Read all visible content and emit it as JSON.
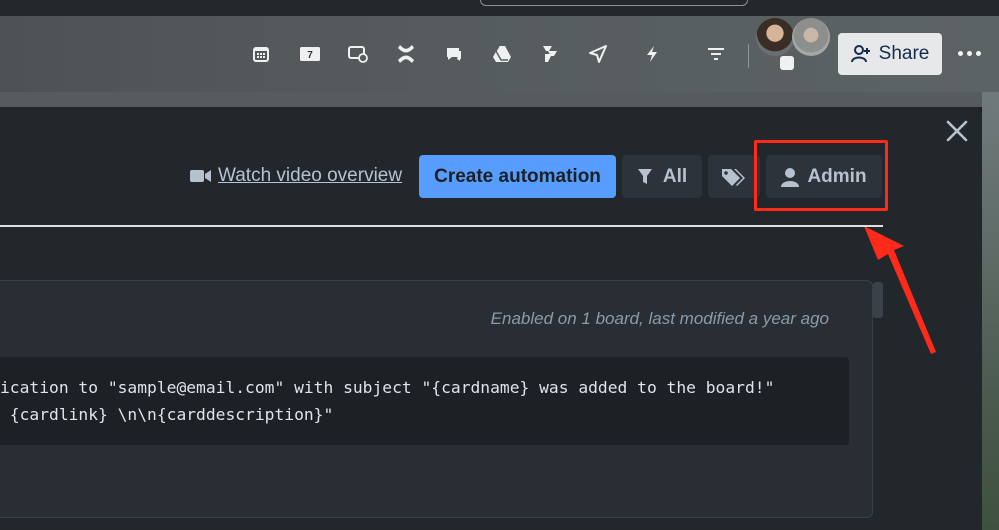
{
  "header": {
    "icons": [
      "calendar-icon",
      "calendar-day-icon",
      "screen-sync-icon",
      "confluence-icon",
      "comment-icon",
      "google-drive-icon",
      "jira-icon",
      "send-icon",
      "lightning-icon",
      "filter-lines-icon"
    ],
    "calendar_day_number": "7",
    "share_label": "Share"
  },
  "toolbar": {
    "video_link": "Watch video overview",
    "create_automation": "Create automation",
    "filter_label": "All",
    "admin_label": "Admin"
  },
  "rule": {
    "meta": "Enabled on 1 board, last modified a year ago",
    "code_line1": "ication to \"sample@email.com\" with subject \"{cardname} was added to the board!\"",
    "code_line2": " {cardlink} \\n\\n{carddescription}\""
  },
  "colors": {
    "accent": "#579dff",
    "highlight": "#ff2a1a",
    "modal_bg": "#22272b",
    "button_bg": "#2c333a"
  }
}
